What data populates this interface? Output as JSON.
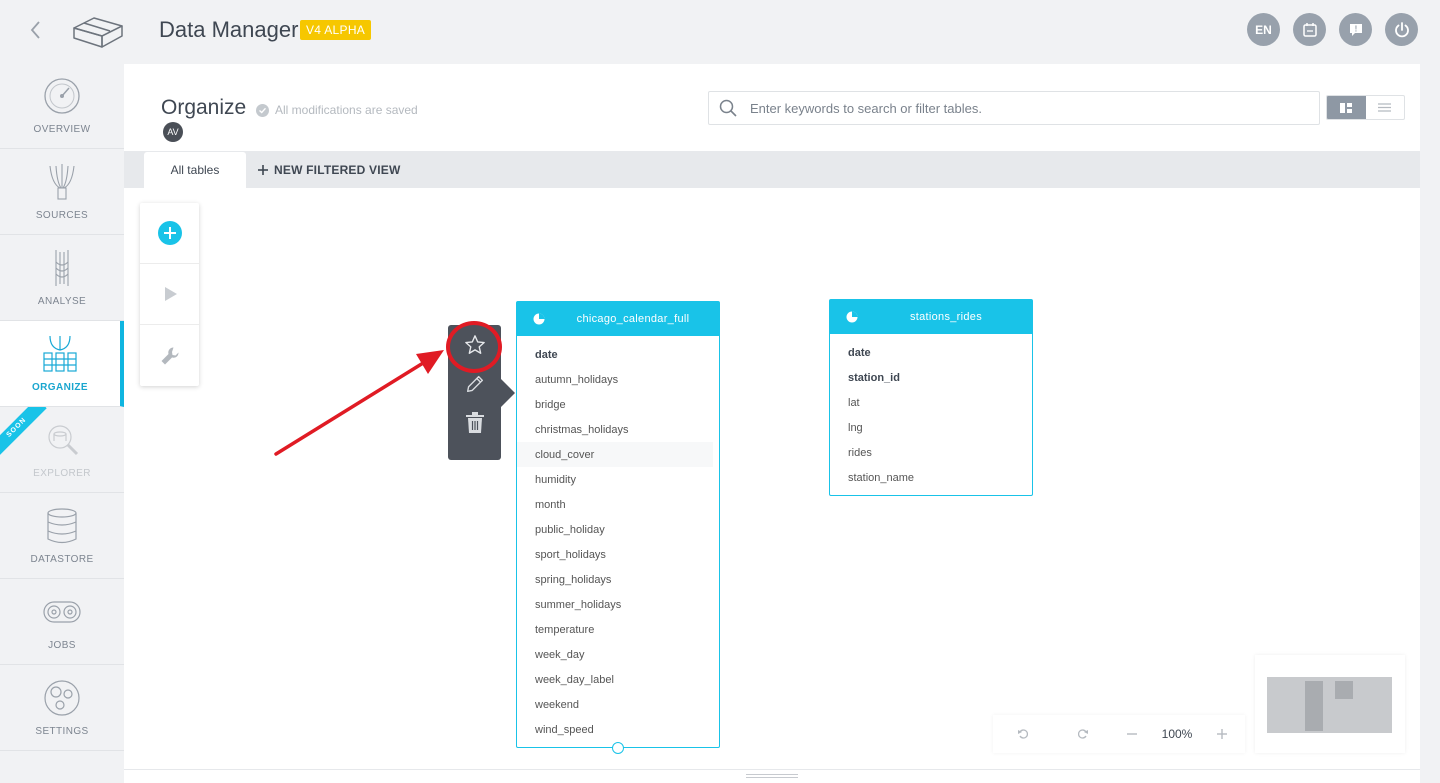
{
  "app": {
    "title": "Data Manager",
    "version": "V4 ALPHA",
    "actions": [
      {
        "name": "language-button",
        "label": "EN"
      },
      {
        "name": "notebook-button",
        "icon": "notebook-icon"
      },
      {
        "name": "help-button",
        "icon": "help-icon"
      },
      {
        "name": "power-button",
        "icon": "power-icon"
      }
    ]
  },
  "sidebar": {
    "items": [
      {
        "key": "overview",
        "label": "OVERVIEW",
        "icon": "gauge-icon"
      },
      {
        "key": "sources",
        "label": "SOURCES",
        "icon": "sources-icon"
      },
      {
        "key": "analyse",
        "label": "ANALYSE",
        "icon": "analyse-icon"
      },
      {
        "key": "organize",
        "label": "ORGANIZE",
        "icon": "organize-icon",
        "active": true
      },
      {
        "key": "explorer",
        "label": "EXPLORER",
        "icon": "explorer-icon",
        "disabled": true,
        "ribbon": "SOON"
      },
      {
        "key": "datastore",
        "label": "DATASTORE",
        "icon": "database-icon"
      },
      {
        "key": "jobs",
        "label": "JOBS",
        "icon": "jobs-icon"
      },
      {
        "key": "settings",
        "label": "SETTINGS",
        "icon": "settings-icon"
      }
    ]
  },
  "page": {
    "title": "Organize",
    "save_status": "All modifications are saved",
    "avatar": "AV"
  },
  "search": {
    "placeholder": "Enter keywords to search or filter tables."
  },
  "tabs": {
    "active": "All tables",
    "new_view": "NEW FILTERED VIEW"
  },
  "tables": [
    {
      "name": "chicago_calendar_full",
      "columns": [
        "date",
        "autumn_holidays",
        "bridge",
        "christmas_holidays",
        "cloud_cover",
        "humidity",
        "month",
        "public_holiday",
        "sport_holidays",
        "spring_holidays",
        "summer_holidays",
        "temperature",
        "week_day",
        "week_day_label",
        "weekend",
        "wind_speed"
      ],
      "key_columns": [
        "date"
      ]
    },
    {
      "name": "stations_rides",
      "columns": [
        "date",
        "station_id",
        "lat",
        "lng",
        "rides",
        "station_name"
      ],
      "key_columns": [
        "date",
        "station_id"
      ]
    }
  ],
  "zoom": {
    "level": "100%"
  },
  "colors": {
    "accent": "#19c3e8",
    "badge": "#f6c700",
    "highlight": "#e01b24"
  }
}
